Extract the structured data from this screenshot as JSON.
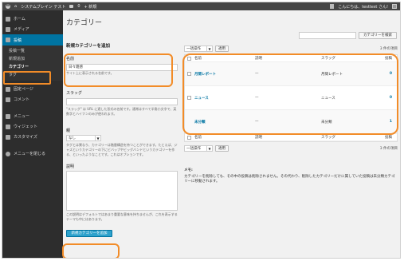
{
  "adminbar": {
    "site_name": "システムブレイン テスト",
    "comments_count": "0",
    "new_label": "+ 新規",
    "greeting": "こんにちは、testtest さん!"
  },
  "sidebar": {
    "items": [
      {
        "label": "ホーム",
        "icon": "dashboard-icon"
      },
      {
        "label": "メディア",
        "icon": "media-icon"
      },
      {
        "label": "投稿",
        "icon": "posts-icon"
      },
      {
        "label": "固定ページ",
        "icon": "pages-icon"
      },
      {
        "label": "コメント",
        "icon": "comments-icon"
      },
      {
        "label": "メニュー",
        "icon": "menu-icon"
      },
      {
        "label": "ウィジェット",
        "icon": "widget-icon"
      },
      {
        "label": "カスタマイズ",
        "icon": "customize-icon"
      },
      {
        "label": "メニューを閉じる",
        "icon": "collapse-icon"
      }
    ],
    "sub": [
      "投稿一覧",
      "新規追加",
      "カテゴリー",
      "タグ"
    ]
  },
  "page": {
    "title": "カテゴリー",
    "search_button": "カテゴリーを検索"
  },
  "form": {
    "heading": "新規カテゴリーを追加",
    "name_label": "名前",
    "name_value": "日々雑感",
    "name_hint": "サイト上に表示される名前です。",
    "slug_label": "スラッグ",
    "slug_hint": "\"スラッグ\" は URL に適した形式の名前です。通常はすべて半角小文字で、英数字とハイフンのみが使われます。",
    "parent_label": "親",
    "parent_value": "なし",
    "parent_hint": "タグとは異なり、カテゴリーは階層構造を持つことができます。たとえば、ジャズというカテゴリーの下にビバップやビッグバンドというカテゴリーを作る、といったようなことです。これはオプションです。",
    "desc_label": "説明",
    "desc_hint": "この説明はデフォルトではあまり重要な意味を持ちませんが、これを表示するテーマも中にはあります。",
    "submit": "新規カテゴリーを追加"
  },
  "list": {
    "bulk_label": "一括操作",
    "apply": "適用",
    "count": "3 件の項目",
    "columns": [
      "名前",
      "説明",
      "スラッグ",
      "投稿"
    ],
    "rows": [
      {
        "name": "月間レポート",
        "desc": "—",
        "slug": "月間レポート",
        "count": "0"
      },
      {
        "name": "ニュース",
        "desc": "—",
        "slug": "ニュース",
        "count": "0"
      },
      {
        "name": "未分類",
        "desc": "—",
        "slug": "未分類",
        "count": "1"
      }
    ],
    "note_head": "メモ:",
    "note_text": "カテゴリーを削除しても、その中の投稿は削除されません。その代わり、削除したカテゴリーだけに属していた投稿は未分類カテゴリーに移動されます。"
  },
  "highlight_color": "#f28c28"
}
